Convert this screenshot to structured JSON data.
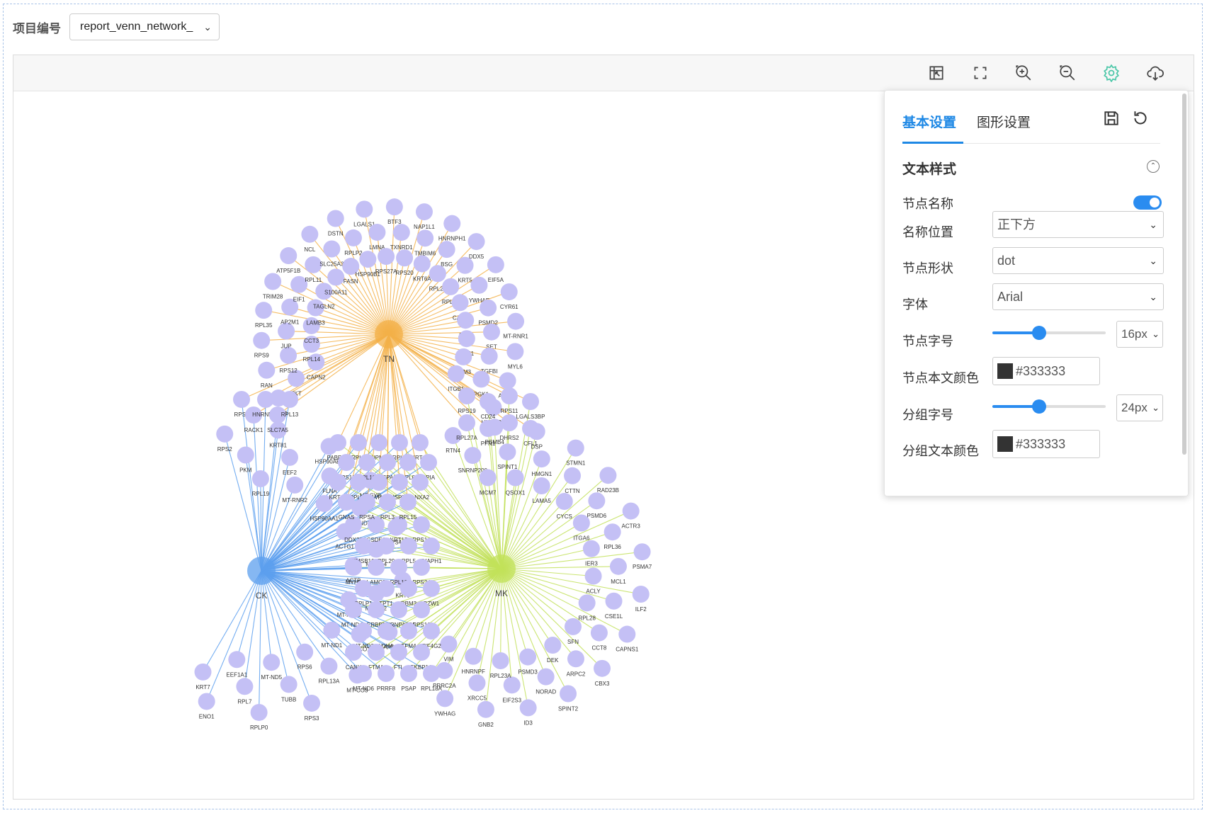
{
  "project": {
    "label": "项目编号",
    "selected": "report_venn_network_"
  },
  "toolbar": {
    "icons": [
      "restore-icon",
      "fullscreen-icon",
      "zoom-in-icon",
      "zoom-out-icon",
      "settings-gear-icon",
      "cloud-download-icon"
    ],
    "active_color": "#4bc7a8"
  },
  "network": {
    "hub_labels": {
      "TN": "TN",
      "CK": "CK",
      "MK": "MK"
    },
    "colors": {
      "TN": "#f3b048",
      "CK": "#5c9fee",
      "MK": "#c2e15a",
      "node": "#c4c0f5",
      "label": "#333333"
    },
    "groups": {
      "TN": [
        "RPL24",
        "TKT",
        "CAPN2",
        "RAN",
        "RPS12",
        "RPL14",
        "RPS9",
        "JUP",
        "CCT3",
        "RPL35",
        "AP2M1",
        "LAMB3",
        "TRIM28",
        "EIF1",
        "TAGLN2",
        "ATP5F1B",
        "RPL11",
        "S100A11",
        "NCL",
        "SLC25A3",
        "FASN",
        "DSTN",
        "RPLP2",
        "HSP90B1",
        "LGALS1",
        "LMNA",
        "RPS27A",
        "BTF3",
        "TXNRD1",
        "RPS20",
        "NAP1L1",
        "TMBIM6",
        "KRT6A",
        "HNRNPH1",
        "BSG",
        "RPL23",
        "DDX5",
        "KRT5",
        "RPL31",
        "EIF5A",
        "YWHAE",
        "CALR",
        "CYR61",
        "PSMD2",
        "ARF1",
        "MT-RNR1",
        "SET",
        "YBX1",
        "MYL6",
        "TGFBI",
        "TPM3",
        "ACTN4",
        "PGK1",
        "ITGB1",
        "HNRNPU"
      ],
      "CK": [
        "RPS2",
        "PKM",
        "RPL19",
        "KRT81",
        "EEF2",
        "MT-RNR2",
        "HSP90AB1",
        "FLNA",
        "HSP90AA1",
        "MT-CYB",
        "MT-ND2",
        "ACTG1",
        "RPS4X",
        "MT-ND4",
        "ACTB",
        "KRT8",
        "MT-CO2",
        "MT-ATP6",
        "GAPDH",
        "MT-CO1",
        "MT-ND1",
        "MT-CO3",
        "RPL13A",
        "RPS6",
        "RPS3",
        "TUBB",
        "MT-ND5",
        "RPLP0",
        "RPL7",
        "EEF1A1",
        "ENO1",
        "KRT7"
      ],
      "MK": [
        "RTN4",
        "SNRNP200",
        "MCM7",
        "PSMB4",
        "SPINT1",
        "QSOX1",
        "DSP",
        "HMGN1",
        "LAMA5",
        "STMN1",
        "CTTN",
        "CYCS",
        "RAD23B",
        "PSMD6",
        "ITGA6",
        "ACTR3",
        "RPL36",
        "IER3",
        "PSMA7",
        "MCL1",
        "ACLY",
        "ILF2",
        "CSE1L",
        "RPL28",
        "CAPNS1",
        "CCT8",
        "SFN",
        "CBX3",
        "ARPC2",
        "DEK",
        "SPINT2",
        "NORAD",
        "PSMD3",
        "ID3",
        "EIF2S3",
        "RPL23A",
        "GNB2",
        "XRCC5",
        "HNRNPF",
        "YWHAG",
        "PRRC2A",
        "VIM"
      ],
      "TN_CK": [
        "RPS8",
        "RACK1",
        "HNRNPA1",
        "SLC7A5",
        "RPL13"
      ],
      "TN_MK": [
        "RPS19",
        "CD24",
        "RPS11",
        "LGALS3BP",
        "RPL27A",
        "PFN1",
        "DHRS2",
        "CFL1"
      ],
      "CK_MK": [
        "DDX21",
        "CSDE1",
        "KRT17",
        "RPS14",
        "TMSB10",
        "RPL29",
        "RPL5",
        "DIAPH1",
        "MYH9",
        "LAMC2",
        "RPL12",
        "RPS24",
        "RPLP1",
        "TPT1",
        "RBM3",
        "BZW1",
        "MT-ND4L",
        "ERBB2",
        "HNRNPA2B1",
        "RPS16",
        "MT-ND3",
        "LDHA",
        "TFM4",
        "EIF4G2",
        "CANX",
        "FTMA",
        "FTL",
        "FKBP1A",
        "MT-ND6",
        "PRRF8",
        "PSAP",
        "RPL18A"
      ],
      "ALL": [
        "PABPC1",
        "RPL4",
        "NPM1",
        "RPL6",
        "KRT19",
        "RPS18",
        "RPL10",
        "HSPA8",
        "RPL8",
        "PPIA",
        "KRT18",
        "RPL7A",
        "YWHAZ",
        "HSPB1",
        "ANXA2",
        "GNAS",
        "RPSA",
        "RPL3",
        "RPL15"
      ]
    }
  },
  "settings": {
    "tabs": [
      "基本设置",
      "图形设置"
    ],
    "section": "文本样式",
    "rows": {
      "node_name": "节点名称",
      "name_pos": "名称位置",
      "name_pos_val": "正下方",
      "node_shape": "节点形状",
      "node_shape_val": "dot",
      "font": "字体",
      "font_val": "Arial",
      "node_size": "节点字号",
      "node_size_val": "16px",
      "node_size_frac": 0.41,
      "node_color": "节点本文颜色",
      "node_color_val": "#333333",
      "group_size": "分组字号",
      "group_size_val": "24px",
      "group_size_frac": 0.41,
      "group_color": "分组文本颜色",
      "group_color_val": "#333333"
    },
    "node_name_on": true,
    "accent": "#2a8cf0"
  }
}
